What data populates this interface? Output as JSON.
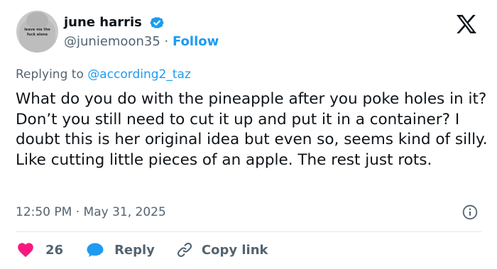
{
  "author": {
    "display_name": "june harris",
    "handle": "@juniemoon35",
    "separator": "·",
    "follow_label": "Follow",
    "avatar_print": "leave me the\nfuck alone",
    "verified_color": "#1d9bf0"
  },
  "reply_context": {
    "prefix": "Replying to ",
    "mention": "@according2_taz"
  },
  "tweet": {
    "text": "What do you do with the pineapple after you poke holes in it? Don’t you still need to cut it up and put it in a container? I doubt this is her original idea but even so, seems kind of silly. Like cutting little pieces of an apple. The rest just rots.",
    "timestamp": "12:50 PM · May 31, 2025"
  },
  "actions": {
    "like_count": "26",
    "reply_label": "Reply",
    "copy_link_label": "Copy link"
  },
  "icons": {
    "brand": "x-logo-icon",
    "verified": "verified-badge-icon",
    "info": "info-icon",
    "like": "heart-icon",
    "reply": "speech-bubble-icon",
    "copy": "link-icon"
  },
  "colors": {
    "accent": "#1d9bf0",
    "like": "#f91880",
    "text": "#0f1419",
    "muted": "#536471"
  }
}
